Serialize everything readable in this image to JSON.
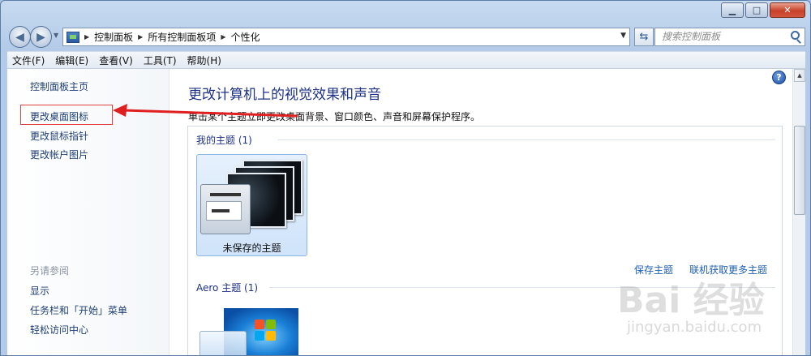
{
  "window": {
    "caption": {
      "minimize": "▁",
      "maximize": "□",
      "close": "✕"
    }
  },
  "nav": {
    "back": "◀",
    "forward": "▶",
    "breadcrumbs": [
      "控制面板",
      "所有控制面板项",
      "个性化"
    ],
    "search_placeholder": "搜索控制面板"
  },
  "menubar": {
    "items": [
      "文件(F)",
      "编辑(E)",
      "查看(V)",
      "工具(T)",
      "帮助(H)"
    ]
  },
  "leftpane": {
    "home": "控制面板主页",
    "tasks": [
      "更改桌面图标",
      "更改鼠标指针",
      "更改帐户图片"
    ],
    "see_also_title": "另请参阅",
    "see_also": [
      "显示",
      "任务栏和「开始」菜单",
      "轻松访问中心"
    ]
  },
  "main": {
    "help": "?",
    "title": "更改计算机上的视觉效果和声音",
    "description": "单击某个主题立即更改桌面背景、窗口颜色、声音和屏幕保护程序。",
    "my_themes_title": "我的主题 (1)",
    "unsaved_theme_label": "未保存的主题",
    "save_theme": "保存主题",
    "get_more_themes": "联机获取更多主题",
    "aero_themes_title": "Aero 主题 (1)"
  },
  "watermark": {
    "logo": "Bai 经验",
    "url": "jingyan.baidu.com"
  },
  "colors": {
    "title_blue": "#1e3287",
    "link_blue": "#1e5fb3",
    "highlight_red": "#e04040"
  }
}
